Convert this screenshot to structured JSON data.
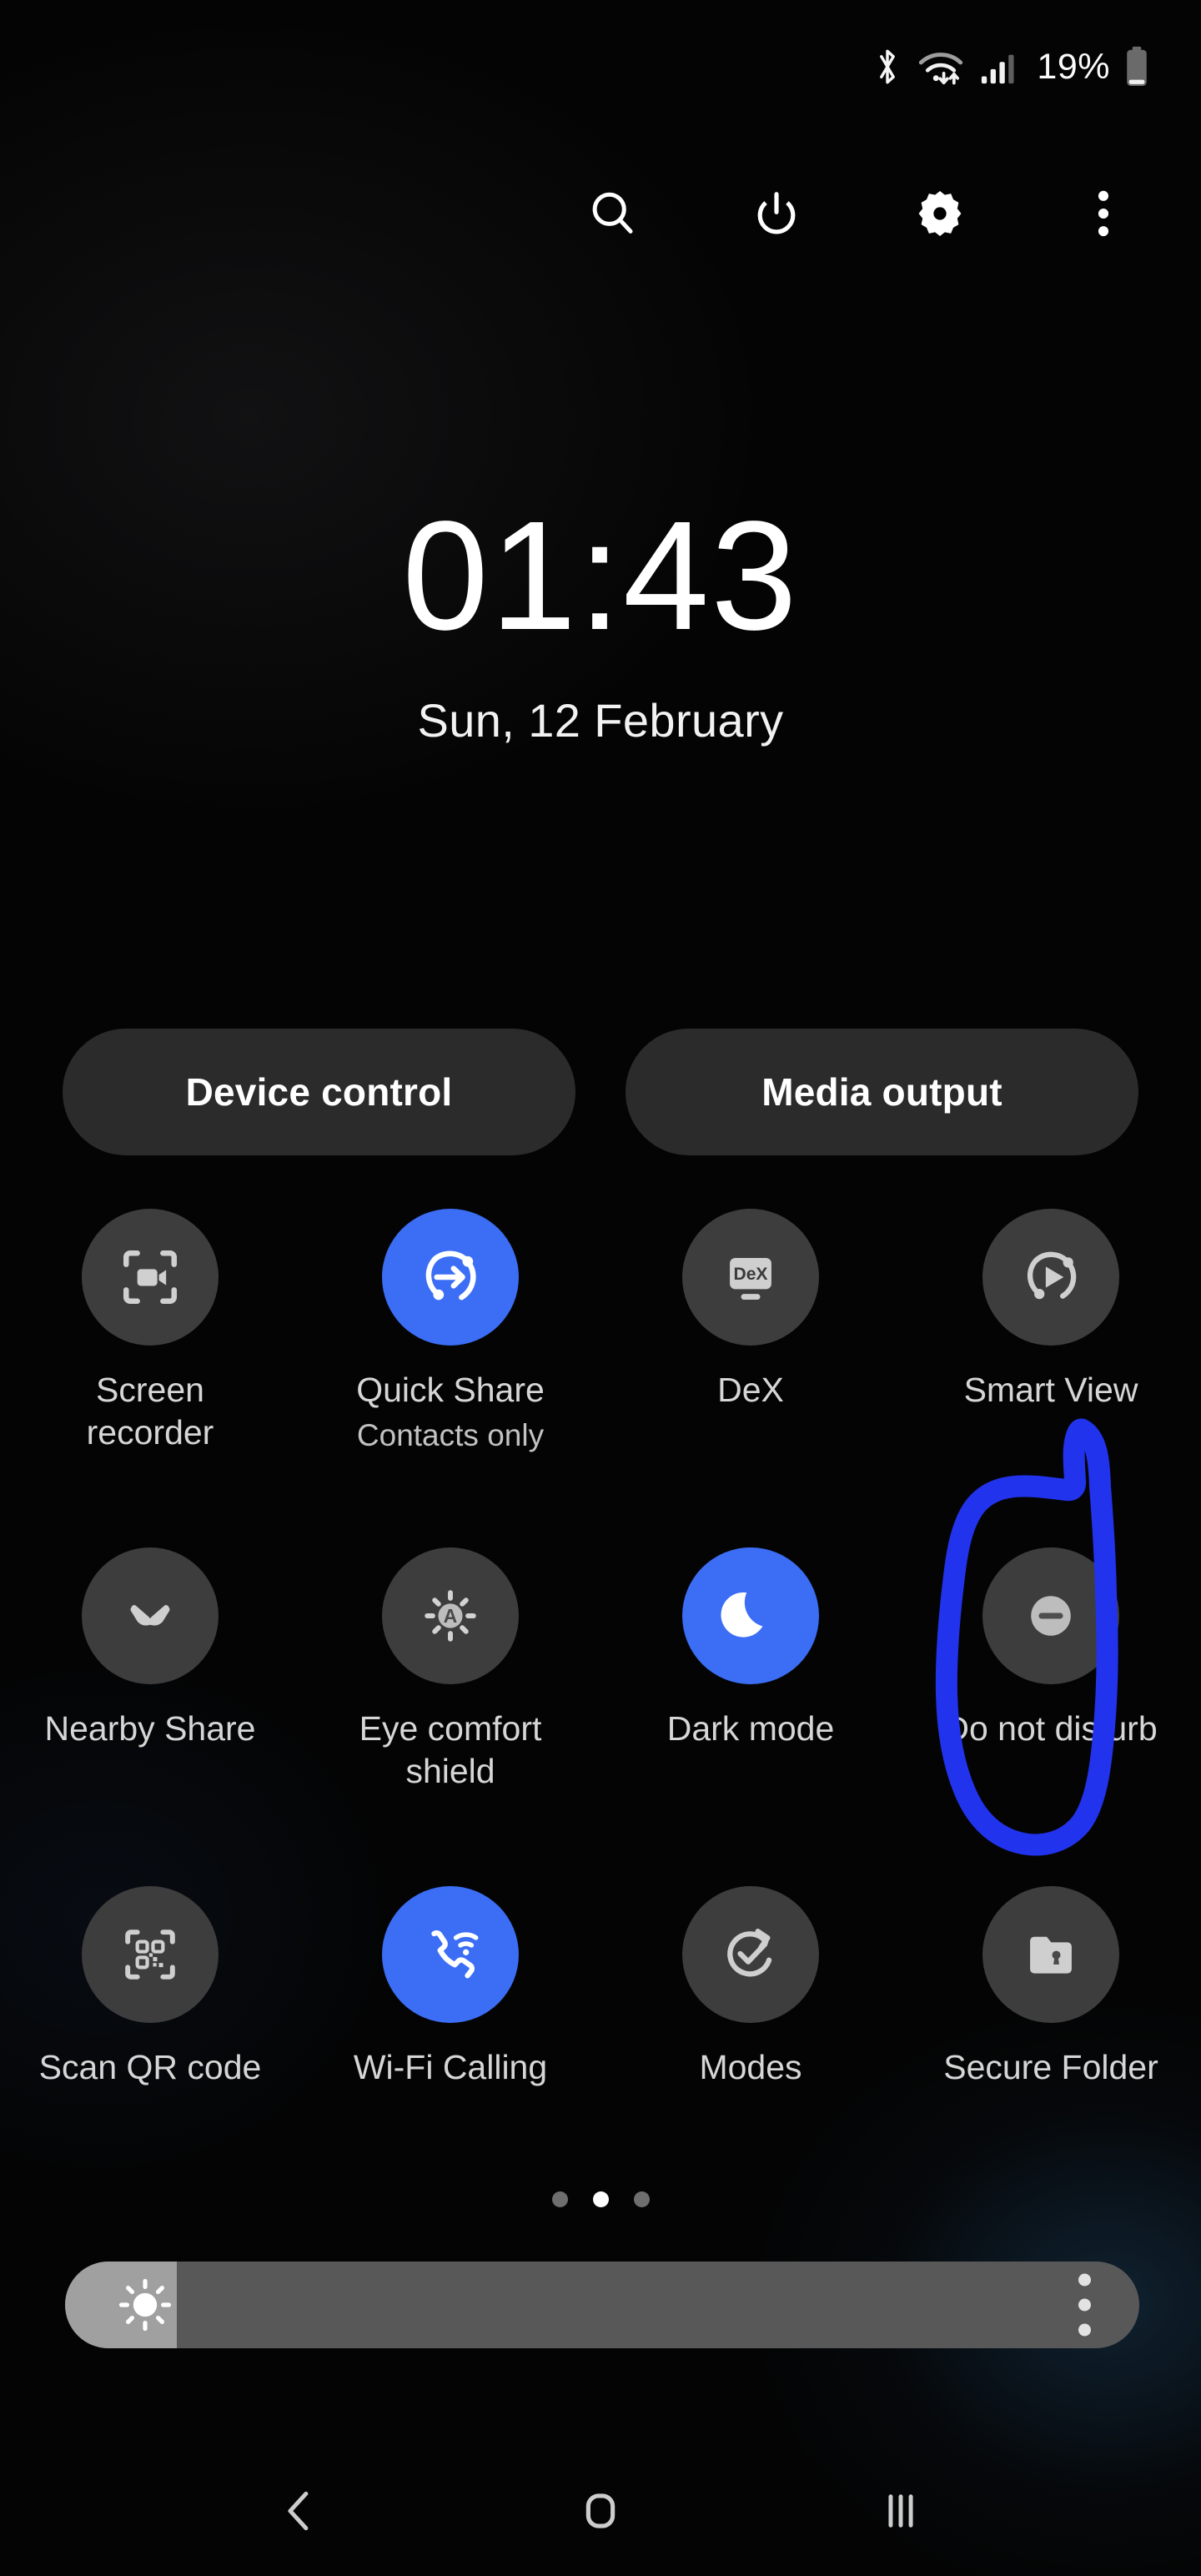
{
  "status_bar": {
    "battery_percent": "19%",
    "icons": [
      "bluetooth-icon",
      "wifi-icon",
      "cellular-signal-icon",
      "battery-icon"
    ]
  },
  "toolbar": {
    "buttons": [
      {
        "name": "search-button",
        "icon": "search-icon"
      },
      {
        "name": "power-button",
        "icon": "power-icon"
      },
      {
        "name": "settings-button",
        "icon": "gear-icon"
      },
      {
        "name": "more-options-button",
        "icon": "overflow-menu-icon"
      }
    ]
  },
  "clock": {
    "time": "01:43",
    "date": "Sun, 12 February"
  },
  "pills": {
    "device_control": "Device control",
    "media_output": "Media output"
  },
  "tiles": [
    {
      "label": "Screen recorder",
      "sub": "",
      "state": "off",
      "icon": "screen-recorder-icon"
    },
    {
      "label": "Quick Share",
      "sub": "Contacts only",
      "state": "on",
      "icon": "quick-share-icon"
    },
    {
      "label": "DeX",
      "sub": "",
      "state": "off",
      "icon": "dex-icon"
    },
    {
      "label": "Smart View",
      "sub": "",
      "state": "off",
      "icon": "smart-view-icon"
    },
    {
      "label": "Nearby Share",
      "sub": "",
      "state": "off",
      "icon": "nearby-share-icon"
    },
    {
      "label": "Eye comfort shield",
      "sub": "",
      "state": "off",
      "icon": "eye-comfort-shield-icon"
    },
    {
      "label": "Dark mode",
      "sub": "",
      "state": "on",
      "icon": "moon-icon"
    },
    {
      "label": "Do not disturb",
      "sub": "",
      "state": "off",
      "icon": "do-not-disturb-icon"
    },
    {
      "label": "Scan QR code",
      "sub": "",
      "state": "off",
      "icon": "qr-code-icon"
    },
    {
      "label": "Wi-Fi Calling",
      "sub": "",
      "state": "on",
      "icon": "wifi-calling-icon"
    },
    {
      "label": "Modes",
      "sub": "",
      "state": "off",
      "icon": "modes-icon"
    },
    {
      "label": "Secure Folder",
      "sub": "",
      "state": "off",
      "icon": "secure-folder-icon"
    }
  ],
  "page_indicator": {
    "total": 3,
    "active_index": 1
  },
  "brightness": {
    "level_percent": 10,
    "menu_icon": "overflow-menu-icon",
    "sun_icon": "brightness-sun-icon"
  },
  "annotation": {
    "shape": "hand-drawn-oval",
    "target": "Do not disturb",
    "color": "#2233ee"
  },
  "nav_bar": {
    "back": "back-icon",
    "home": "home-icon",
    "recents": "recents-icon"
  },
  "colors": {
    "accent_blue": "#3b6ef5",
    "tile_off": "#3d3d3d",
    "pill_bg": "#2b2b2b",
    "annotation_blue": "#2233ee",
    "background": "#040404"
  }
}
